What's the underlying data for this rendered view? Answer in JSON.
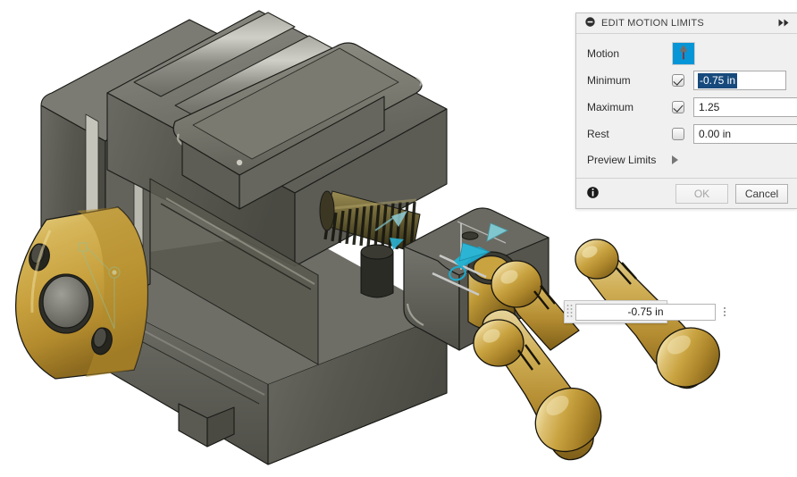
{
  "viewport": {
    "name": "3d-model-viewport",
    "model": "machinist-vise-assembly",
    "background_color": "#ffffff",
    "materials": {
      "body_gray": "#6e6e68",
      "brass": "#c9a martin",
      "brass_color": "#c6a24a",
      "manipulator_color": "#0aa6c9"
    },
    "inline_editor": {
      "value": "-0.75 in",
      "grip_icon": "drag-grip-icon",
      "menu_icon": "more-options-icon"
    },
    "manipulator": {
      "name": "slide-joint-manipulator",
      "arrow_color": "#3ab4cf"
    }
  },
  "dialog": {
    "title": "EDIT MOTION LIMITS",
    "collapse_icon": "collapse-minus-icon",
    "expand_icon": "double-chevron-right-icon",
    "rows": {
      "motion": {
        "label": "Motion",
        "icon": "slider-motion-icon",
        "accent_color": "#0696d7"
      },
      "minimum": {
        "label": "Minimum",
        "checked": true,
        "value": "-0.75 in",
        "selected": true
      },
      "maximum": {
        "label": "Maximum",
        "checked": true,
        "value": "1.25",
        "selected": false
      },
      "rest": {
        "label": "Rest",
        "checked": false,
        "value": "0.00 in",
        "selected": false
      },
      "preview_limits": {
        "label": "Preview Limits",
        "icon": "expand-triangle-icon"
      }
    },
    "footer": {
      "info_icon": "info-icon",
      "ok_label": "OK",
      "ok_disabled": true,
      "cancel_label": "Cancel"
    }
  }
}
